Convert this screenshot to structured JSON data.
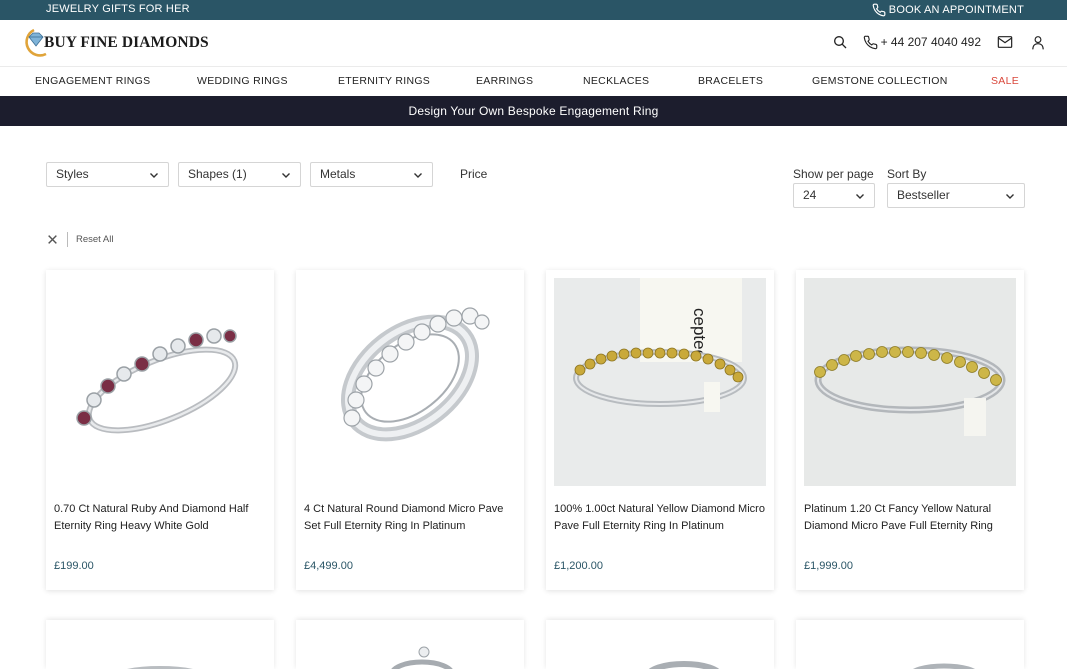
{
  "topbar": {
    "left_text": "JEWELRY GIFTS FOR HER",
    "appointment": "BOOK AN APPOINTMENT"
  },
  "header": {
    "logo_text": "BUY FINE DIAMONDS",
    "phone": "+ 44 207 4040 492"
  },
  "nav": {
    "items": [
      "ENGAGEMENT RINGS",
      "WEDDING RINGS",
      "ETERNITY RINGS",
      "EARRINGS",
      "NECKLACES",
      "BRACELETS",
      "GEMSTONE COLLECTION",
      "SALE"
    ]
  },
  "banner": {
    "text": "Design Your Own Bespoke Engagement Ring"
  },
  "filters": {
    "styles": "Styles",
    "shapes": "Shapes (1)",
    "metals": "Metals",
    "price": "Price",
    "per_page_label": "Show per page",
    "per_page_value": "24",
    "sort_label": "Sort By",
    "sort_value": "Bestseller",
    "reset": "Reset All"
  },
  "products": [
    {
      "name": "0.70 Ct Natural Ruby And Diamond Half Eternity Ring Heavy White Gold",
      "price": "£199.00"
    },
    {
      "name": "4 Ct Natural Round Diamond Micro Pave Set Full Eternity Ring In Platinum",
      "price": "£4,499.00"
    },
    {
      "name": "100% 1.00ct Natural Yellow Diamond Micro Pave Full Eternity Ring In Platinum",
      "price": "£1,200.00"
    },
    {
      "name": "Platinum 1.20 Ct Fancy Yellow Natural Diamond Micro Pave Full Eternity Ring",
      "price": "£1,999.00"
    }
  ],
  "photo_label_text": "cepted",
  "colors": {
    "topbar": "#2a5566",
    "banner": "#1c1d2d",
    "sale": "#d9473b",
    "price": "#2a5566"
  }
}
